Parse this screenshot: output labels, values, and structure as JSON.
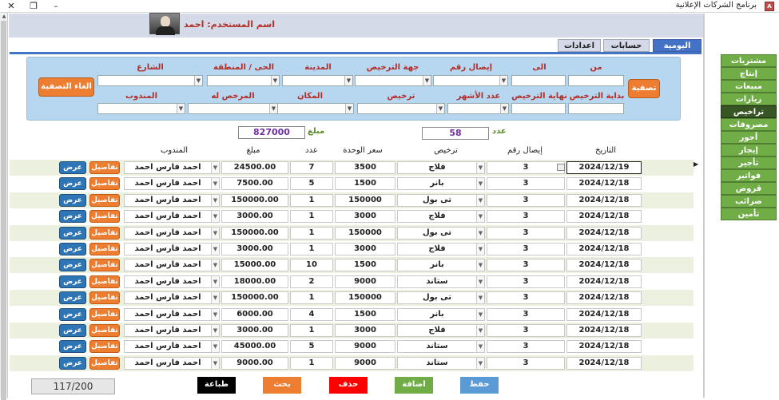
{
  "window": {
    "title": "برنامج الشركات الإعلانية",
    "icon_text": "A"
  },
  "header": {
    "username_label": "اسم المستخدم: احمد"
  },
  "tabs": [
    {
      "label": "اليومية",
      "active": true
    },
    {
      "label": "حسابات",
      "active": false
    },
    {
      "label": "اعدادات",
      "active": false
    }
  ],
  "filters": {
    "from": "من",
    "to": "الى",
    "receipt_no": "إيصال رقم",
    "license_authority": "جهة الترخيص",
    "city": "المدينة",
    "district": "الحى / المنطقة",
    "street": "الشارع",
    "license_start": "بداية الترخيص",
    "license_end": "نهاية الترخيص",
    "months_count": "عدد الأشهر",
    "license": "ترخيص",
    "place": "المكان",
    "licensee": "المرخص له",
    "representative": "المندوب",
    "filter_button": "تصفية",
    "cancel_filter_button": "الغاء التصفية"
  },
  "sidebar": [
    {
      "label": "مشتريات",
      "active": false
    },
    {
      "label": "إنتاج",
      "active": false
    },
    {
      "label": "مبيعات",
      "active": false
    },
    {
      "label": "زيارات",
      "active": false
    },
    {
      "label": "تراخيص",
      "active": true
    },
    {
      "label": "مصروفات",
      "active": false
    },
    {
      "label": "أجور",
      "active": false
    },
    {
      "label": "إيجار",
      "active": false
    },
    {
      "label": "تأجير",
      "active": false
    },
    {
      "label": "فواتير",
      "active": false
    },
    {
      "label": "قروض",
      "active": false
    },
    {
      "label": "ضرائب",
      "active": false
    },
    {
      "label": "تأمين",
      "active": false
    }
  ],
  "summary": {
    "count_label": "عدد",
    "count_value": "58",
    "amount_label": "مبلغ",
    "amount_value": "827000"
  },
  "columns": {
    "date": "التاريخ",
    "receipt": "إيصال رقم",
    "license": "ترخيص",
    "unit_price": "سعر الوحدة",
    "count": "عدد",
    "amount": "مبلغ",
    "rep": "المندوب"
  },
  "row_buttons": {
    "details": "تفاصيل",
    "view": "عرض"
  },
  "rows": [
    {
      "date": "2024/12/19",
      "receipt": "3",
      "license": "فلاج",
      "unit_price": "3500",
      "count": "7",
      "amount": "24500.00",
      "rep": "احمد فارس احمد"
    },
    {
      "date": "2024/12/18",
      "receipt": "3",
      "license": "بانر",
      "unit_price": "1500",
      "count": "5",
      "amount": "7500.00",
      "rep": "احمد فارس احمد"
    },
    {
      "date": "2024/12/18",
      "receipt": "3",
      "license": "تى بول",
      "unit_price": "150000",
      "count": "1",
      "amount": "150000.00",
      "rep": "احمد فارس احمد"
    },
    {
      "date": "2024/12/18",
      "receipt": "3",
      "license": "فلاج",
      "unit_price": "3000",
      "count": "1",
      "amount": "3000.00",
      "rep": "احمد فارس احمد"
    },
    {
      "date": "2024/12/18",
      "receipt": "3",
      "license": "تى بول",
      "unit_price": "150000",
      "count": "1",
      "amount": "150000.00",
      "rep": "احمد فارس احمد"
    },
    {
      "date": "2024/12/18",
      "receipt": "3",
      "license": "فلاج",
      "unit_price": "3000",
      "count": "1",
      "amount": "3000.00",
      "rep": "احمد فارس احمد"
    },
    {
      "date": "2024/12/18",
      "receipt": "3",
      "license": "بانر",
      "unit_price": "1500",
      "count": "10",
      "amount": "15000.00",
      "rep": "احمد فارس احمد"
    },
    {
      "date": "2024/12/18",
      "receipt": "3",
      "license": "ستاند",
      "unit_price": "9000",
      "count": "2",
      "amount": "18000.00",
      "rep": "احمد فارس احمد"
    },
    {
      "date": "2024/12/18",
      "receipt": "3",
      "license": "تى بول",
      "unit_price": "150000",
      "count": "1",
      "amount": "150000.00",
      "rep": "احمد فارس احمد"
    },
    {
      "date": "2024/12/18",
      "receipt": "3",
      "license": "بانر",
      "unit_price": "1500",
      "count": "4",
      "amount": "6000.00",
      "rep": "احمد فارس احمد"
    },
    {
      "date": "2024/12/18",
      "receipt": "3",
      "license": "فلاج",
      "unit_price": "3000",
      "count": "1",
      "amount": "3000.00",
      "rep": "احمد فارس احمد"
    },
    {
      "date": "2024/12/18",
      "receipt": "3",
      "license": "ستاند",
      "unit_price": "9000",
      "count": "5",
      "amount": "45000.00",
      "rep": "احمد فارس احمد"
    },
    {
      "date": "2024/12/18",
      "receipt": "3",
      "license": "ستاند",
      "unit_price": "9000",
      "count": "1",
      "amount": "9000.00",
      "rep": "احمد فارس احمد"
    }
  ],
  "footer": {
    "record_counter": "117/200",
    "print": "طباعة",
    "search": "بحث",
    "delete": "حذف",
    "add": "اضافة",
    "save": "حفظ"
  },
  "colors": {
    "accent_blue": "#4472c4",
    "orange": "#ed7d31",
    "green": "#70ad47",
    "red": "#ff0000",
    "black": "#000000",
    "label_red": "#b32d28"
  }
}
